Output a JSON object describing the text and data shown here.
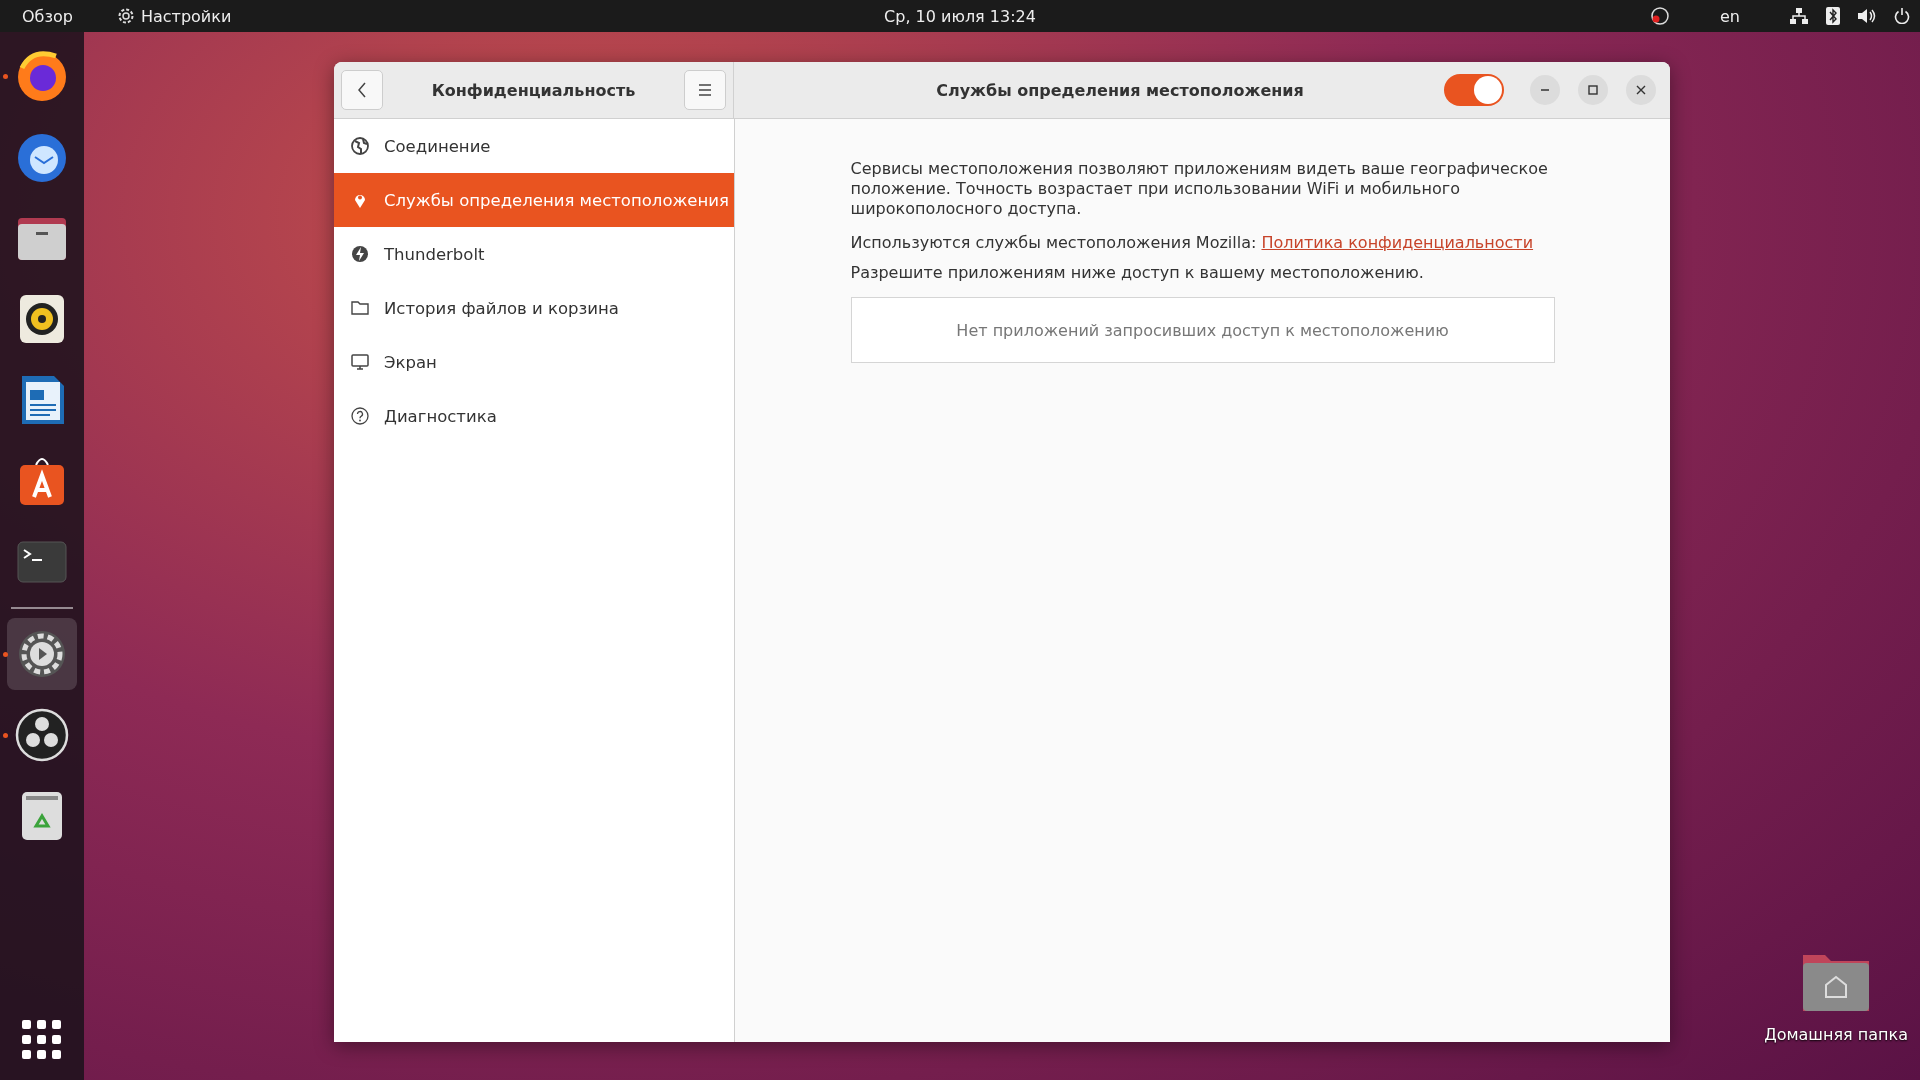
{
  "top_bar": {
    "activities": "Обзор",
    "app_menu": "Настройки",
    "clock": "Ср, 10 июля  13:24",
    "keyboard_layout": "en"
  },
  "dock": {
    "apps": [
      {
        "kind": "browser",
        "running": true,
        "selected": false
      },
      {
        "kind": "mail",
        "running": false,
        "selected": false
      },
      {
        "kind": "files",
        "running": false,
        "selected": false
      },
      {
        "kind": "music",
        "running": false,
        "selected": false
      },
      {
        "kind": "writer",
        "running": false,
        "selected": false
      },
      {
        "kind": "store",
        "running": false,
        "selected": false
      },
      {
        "kind": "terminal",
        "running": false,
        "selected": false
      },
      {
        "kind": "settings",
        "running": true,
        "selected": true
      },
      {
        "kind": "recorder",
        "running": true,
        "selected": false
      },
      {
        "kind": "trash",
        "running": false,
        "selected": false
      }
    ]
  },
  "window": {
    "sidebar_title": "Конфиденциальность",
    "title": "Службы определения местоположения",
    "location_enabled": true,
    "sidebar": {
      "items": [
        {
          "label": "Соединение",
          "kind": "globe",
          "selected": false
        },
        {
          "label": "Службы определения местоположения",
          "kind": "pin",
          "selected": true
        },
        {
          "label": "Thunderbolt",
          "kind": "bolt",
          "selected": false
        },
        {
          "label": "История файлов и корзина",
          "kind": "folder",
          "selected": false
        },
        {
          "label": "Экран",
          "kind": "monitor",
          "selected": false
        },
        {
          "label": "Диагностика",
          "kind": "help",
          "selected": false
        }
      ]
    },
    "description": "Сервисы местоположения позволяют приложениям видеть ваше географическое положение. Точность возрастает при использовании WiFi и мобильного широкополосного доступа.",
    "provider_text": "Используются службы местоположения Mozilla:",
    "provider_link": "Политика конфиденциальности",
    "apps_hint": "Разрешите приложениям ниже доступ к вашему местоположению.",
    "apps_empty": "Нет приложений запросивших доступ к местоположению"
  },
  "desktop": {
    "icons": [
      {
        "label": "Домашняя папка"
      }
    ]
  }
}
